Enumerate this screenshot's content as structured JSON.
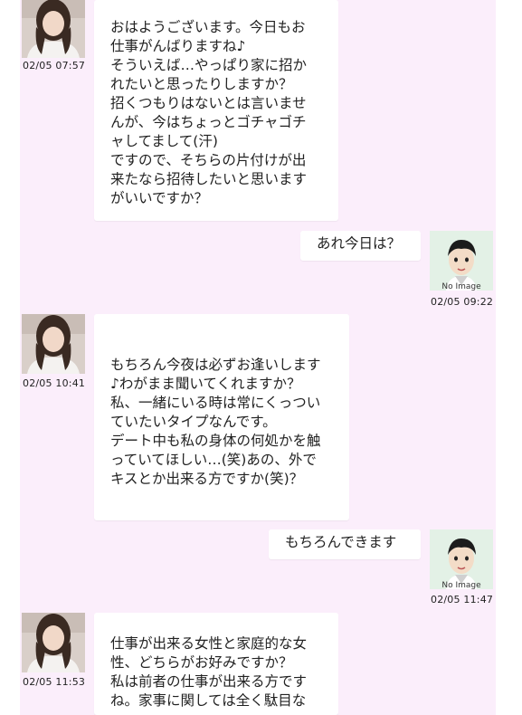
{
  "messages": [
    {
      "sender": "partner",
      "timestamp": "02/05 07:57",
      "text": "おはようございます。今日もお\n仕事がんばりますね♪\nそういえば…やっぱり家に招か\nれたいと思ったりしますか？\n招くつもりはないとは言いませ\nんが、今はちょっとゴチャゴチ\nャしてまして(汗)\nですので、そちらの片付けが出\n来たなら招待したいと思います\nがいいですか？"
    },
    {
      "sender": "me",
      "timestamp": "02/05 09:22",
      "text": "あれ今日は？",
      "avatar_label": "No Image"
    },
    {
      "sender": "partner",
      "timestamp": "02/05 10:41",
      "text": "もちろん今夜は必ずお逢いします\n♪わがまま聞いてくれますか？\n私、一緒にいる時は常にくっつい\nていたいタイプなんです。\nデート中も私の身体の何処かを触\nっていてほしい…(笑)あの、外で\nキスとか出来る方ですか(笑)？"
    },
    {
      "sender": "me",
      "timestamp": "02/05 11:47",
      "text": "もちろんできます",
      "avatar_label": "No Image"
    },
    {
      "sender": "partner",
      "timestamp": "02/05 11:53",
      "text": "仕事が出来る女性と家庭的な女\n性、どちらがお好みですか？\n私は前者の仕事が出来る方です\nね。家事に関しては全く駄目な"
    }
  ]
}
